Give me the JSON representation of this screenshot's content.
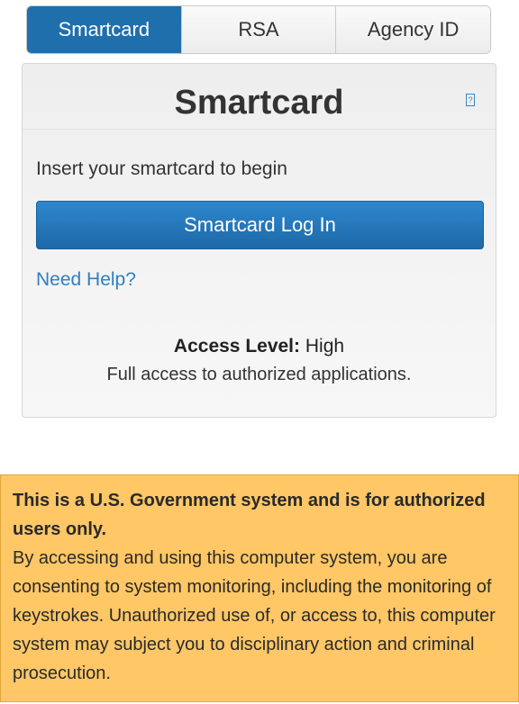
{
  "tabs": [
    {
      "label": "Smartcard",
      "active": true
    },
    {
      "label": "RSA",
      "active": false
    },
    {
      "label": "Agency ID",
      "active": false
    }
  ],
  "panel": {
    "title": "Smartcard",
    "help_icon": {
      "icon": "help-icon",
      "glyph": "?"
    },
    "instruction": "Insert your smartcard to begin",
    "login_button": "Smartcard Log In",
    "help_link": "Need Help?",
    "access_level_label": "Access Level:",
    "access_level_value": "High",
    "access_description": "Full access to authorized applications."
  },
  "warning": {
    "title": "This is a U.S. Government system and is for authorized users only.",
    "body": "By accessing and using this computer system, you are consenting to system monitoring, including the monitoring of keystrokes. Unauthorized use of, or access to, this computer system may subject you to disciplinary action and criminal prosecution."
  },
  "colors": {
    "active_tab": "#1f6fad",
    "button": "#2e87cd",
    "link": "#2f7fc0",
    "warning_bg": "#ffc766"
  }
}
